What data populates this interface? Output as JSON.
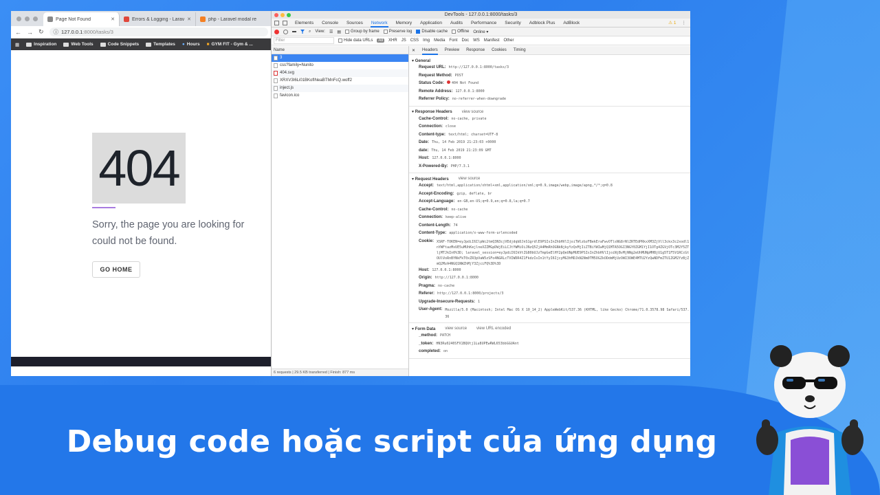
{
  "browser": {
    "tabs": [
      {
        "title": "Page Not Found",
        "favicon_color": "#888888"
      },
      {
        "title": "Errors & Logging - Laravel - Th",
        "favicon_color": "#e0473b"
      },
      {
        "title": "php - Laravel modal re",
        "favicon_color": "#f48024"
      }
    ],
    "url_host": "127.0.0.1",
    "url_path": ":8000/tasks/3",
    "bookmarks": [
      "Inspiration",
      "Web Tools",
      "Code Snippets",
      "Templates",
      "Hours",
      "GYM FIT - Gym & ..."
    ],
    "page": {
      "code": "404",
      "message": "Sorry, the page you are looking for could not be found.",
      "button": "GO HOME"
    }
  },
  "devtools": {
    "title": "DevTools - 127.0.0.1:8000/tasks/3",
    "panels": [
      "Elements",
      "Console",
      "Sources",
      "Network",
      "Memory",
      "Application",
      "Audits",
      "Performance",
      "Security",
      "Adblock Plus",
      "AdBlock"
    ],
    "active_panel": "Network",
    "warnings": "1",
    "toolbar": {
      "view": "View:",
      "group_by_frame": "Group by frame",
      "preserve_log": "Preserve log",
      "disable_cache": "Disable cache",
      "offline": "Offline",
      "online": "Online"
    },
    "filter": {
      "placeholder": "Filter",
      "hide_data_urls": "Hide data URLs",
      "types": [
        "All",
        "XHR",
        "JS",
        "CSS",
        "Img",
        "Media",
        "Font",
        "Doc",
        "WS",
        "Manifest",
        "Other"
      ]
    },
    "name_header": "Name",
    "requests": [
      "3",
      "css?family=Nunito",
      "404.svg",
      "XRXV3I6Li01BKofINeaBTMnFcQ.woff2",
      "inject.js",
      "favicon.ico"
    ],
    "status": "6 requests | 29.5 KB transferred | Finish: 877 ms",
    "subtabs": [
      "Headers",
      "Preview",
      "Response",
      "Cookies",
      "Timing"
    ],
    "general": {
      "title": "General",
      "rows": [
        {
          "k": "Request URL:",
          "v": "http://127.0.0.1:8000/tasks/3"
        },
        {
          "k": "Request Method:",
          "v": "POST"
        },
        {
          "k": "Status Code:",
          "v": "404 Not Found"
        },
        {
          "k": "Remote Address:",
          "v": "127.0.0.1:8000"
        },
        {
          "k": "Referrer Policy:",
          "v": "no-referrer-when-downgrade"
        }
      ]
    },
    "response_headers": {
      "title": "Response Headers",
      "view_source": "view source",
      "rows": [
        {
          "k": "Cache-Control:",
          "v": "no-cache, private"
        },
        {
          "k": "Connection:",
          "v": "close"
        },
        {
          "k": "Content-type:",
          "v": "text/html; charset=UTF-8"
        },
        {
          "k": "Date:",
          "v": "Thu, 14 Feb 2019 21:23:03 +0000"
        },
        {
          "k": "date:",
          "v": "Thu, 14 Feb 2019 21:23:09 GMT"
        },
        {
          "k": "Host:",
          "v": "127.0.0.1:8000"
        },
        {
          "k": "X-Powered-By:",
          "v": "PHP/7.3.1"
        }
      ]
    },
    "request_headers": {
      "title": "Request Headers",
      "view_source": "view source",
      "rows": [
        {
          "k": "Accept:",
          "v": "text/html,application/xhtml+xml,application/xml;q=0.9,image/webp,image/apng,*/*;q=0.8"
        },
        {
          "k": "Accept-Encoding:",
          "v": "gzip, deflate, br"
        },
        {
          "k": "Accept-Language:",
          "v": "en-GB,en-US;q=0.9,en;q=0.8,la;q=0.7"
        },
        {
          "k": "Cache-Control:",
          "v": "no-cache"
        },
        {
          "k": "Connection:",
          "v": "keep-alive"
        },
        {
          "k": "Content-Length:",
          "v": "74"
        },
        {
          "k": "Content-Type:",
          "v": "application/x-www-form-urlencoded"
        },
        {
          "k": "Cookie:",
          "v": "XSRF-TOKEN=eyJpdiI6IlpWc2tmQ3N3cjVEdjdqbDJnS1grdlE9PSIsInZhbHVlIjoiTWlzbzFBekEraFwvOTlsNG8rNlZRTEdPRkxXM3ZjVll3ckx3c2xodl1nYWFtazMxUE5uMUhKejlneXZZMGpDWjEiLCJtYWMiOiJNzQ5ZjA4MmRhOGNkNjkyYzQxMjIiZTBiYWIwMjQ1MTA5OGI3NGY0ZGM1YjI1OTg4ZGVjOTc3M2Y5ZTljMTJkIn0%3D; laravel_session=eyJpdiI6IkVtZG80bUJzTmpGeElHY2pQeUNpMUE9PSIsInZhbHVlIjoiNjBvMjNNg2eUhMUNpMHBjU1g5T1F5V1RCcGtOUlVoRnBYNkFkT0xZR3pVaW5zSFo4NGRLcTVIWDR4Z1FkdzIsIn1tYyI6IjcyMG3hMDJkN2Nm0TM5OGZkODdmMjUzOWI3OWE4MTU2YzQwNDFmZTU1ZGM2YzBjZmQ2MzA4NGQ1NWZhMjY3ZjciFQ%3D%3D"
        },
        {
          "k": "Host:",
          "v": "127.0.0.1:8000"
        },
        {
          "k": "Origin:",
          "v": "http://127.0.0.1:8000"
        },
        {
          "k": "Pragma:",
          "v": "no-cache"
        },
        {
          "k": "Referer:",
          "v": "http://127.0.0.1:8000/projects/3"
        },
        {
          "k": "Upgrade-Insecure-Requests:",
          "v": "1"
        },
        {
          "k": "User-Agent:",
          "v": "Mozilla/5.0 (Macintosh; Intel Mac OS X 10_14_2) AppleWebKit/537.36 (KHTML, like Gecko) Chrome/71.0.3578.98 Safari/537.36"
        }
      ]
    },
    "form_data": {
      "title": "Form Data",
      "view_source": "view source",
      "view_url_encoded": "view URL encoded",
      "rows": [
        {
          "k": "_method:",
          "v": "PATCH"
        },
        {
          "k": "_token:",
          "v": "HN3Ru0240SFX1BQUtj1Lu8UPEwRWL653bbGGUAnt"
        },
        {
          "k": "completed:",
          "v": "on"
        }
      ]
    }
  },
  "headline": "Debug code hoặc script của ứng dụng",
  "colors": {
    "accent": "#1a73e8",
    "background": "#2b86f0",
    "underline": "#a87be0"
  }
}
